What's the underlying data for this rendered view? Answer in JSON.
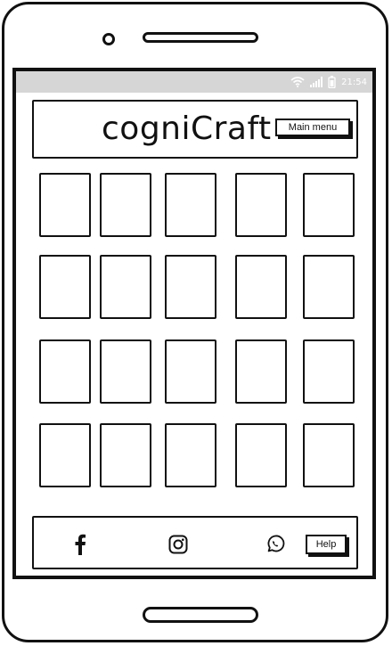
{
  "status_bar": {
    "time": "21:54",
    "icons": [
      "wifi-icon",
      "signal-icon",
      "battery-icon"
    ]
  },
  "header": {
    "title": "cogniCraft",
    "main_menu_label": "Main menu"
  },
  "grid": {
    "rows": 4,
    "columns": 5
  },
  "footer": {
    "icons": [
      "facebook-icon",
      "instagram-icon",
      "whatsapp-icon"
    ],
    "help_label": "Help"
  }
}
